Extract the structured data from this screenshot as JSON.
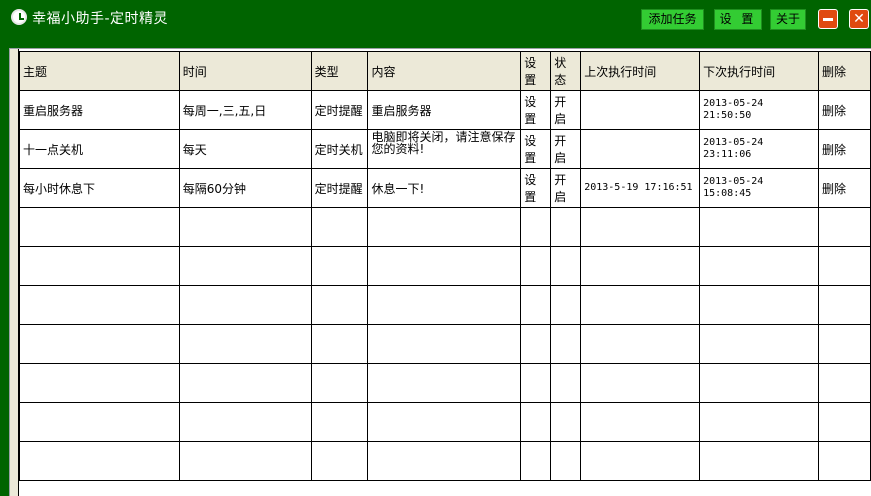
{
  "window": {
    "title": "幸福小助手-定时精灵",
    "buttons": {
      "add_task": "添加任务",
      "settings": "设 置",
      "about": "关于"
    },
    "colors": {
      "titlebar": "#006400",
      "button": "#33cc33",
      "window_control": "#e04a10"
    }
  },
  "table": {
    "headers": {
      "subject": "主题",
      "time": "时间",
      "type": "类型",
      "content": "内容",
      "settings": "设置",
      "status": "状态",
      "last_run": "上次执行时间",
      "next_run": "下次执行时间",
      "delete": "删除"
    },
    "rows": [
      {
        "subject": "重启服务器",
        "time": "每周一,三,五,日",
        "type": "定时提醒",
        "content": "重启服务器",
        "settings": "设置",
        "status": "开启",
        "last_run": "",
        "next_run": "2013-05-24 21:50:50",
        "delete": "删除"
      },
      {
        "subject": "十一点关机",
        "time": "每天",
        "type": "定时关机",
        "content": "电脑即将关闭，请注意保存您的资料!",
        "settings": "设置",
        "status": "开启",
        "last_run": "",
        "next_run": "2013-05-24 23:11:06",
        "delete": "删除"
      },
      {
        "subject": "每小时休息下",
        "time": "每隔60分钟",
        "type": "定时提醒",
        "content": "休息一下!",
        "settings": "设置",
        "status": "开启",
        "last_run": "2013-5-19 17:16:51",
        "next_run": "2013-05-24 15:08:45",
        "delete": "删除"
      }
    ],
    "empty_rows": 7
  }
}
